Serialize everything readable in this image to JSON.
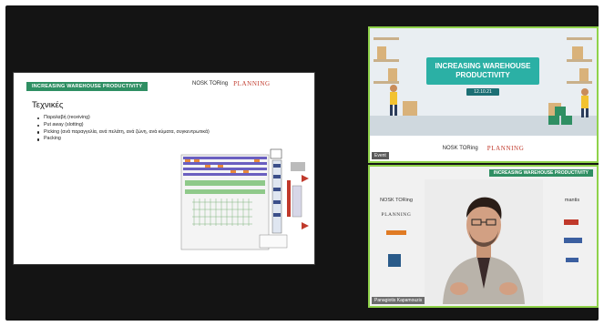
{
  "slide": {
    "banner": "INCREASING WAREHOUSE PRODUCTIVITY",
    "logo_left": "NOSK TORing",
    "logo_right": "PLANNING",
    "title": "Τεχνικές",
    "bullets": [
      "Παραλαβή (receiving)",
      "Put away (slotting)",
      "Picking (ανά παραγγελία, ανά πελάτη, ανά ζώνη, ανά κύματα, συγκεντρωτικά)",
      "Packing"
    ]
  },
  "presenter1": {
    "banner": "INCREASING WAREHOUSE PRODUCTIVITY",
    "date": "12.10.21",
    "footer_logo_left": "NOSK TORing",
    "footer_logo_right": "PLANNING",
    "tag": "Event"
  },
  "presenter2": {
    "banner": "INCREASING WAREHOUSE PRODUCTIVITY",
    "left_logos": [
      "NOSK TORing",
      "PLANNING"
    ],
    "right_logos": [
      "mantis"
    ],
    "name": "Panagiotis Kapamouzis"
  },
  "colors": {
    "stage": "#141414",
    "accent_green": "#8fd24a",
    "banner_green": "#2f8f63",
    "teal": "#2bb0a5"
  }
}
